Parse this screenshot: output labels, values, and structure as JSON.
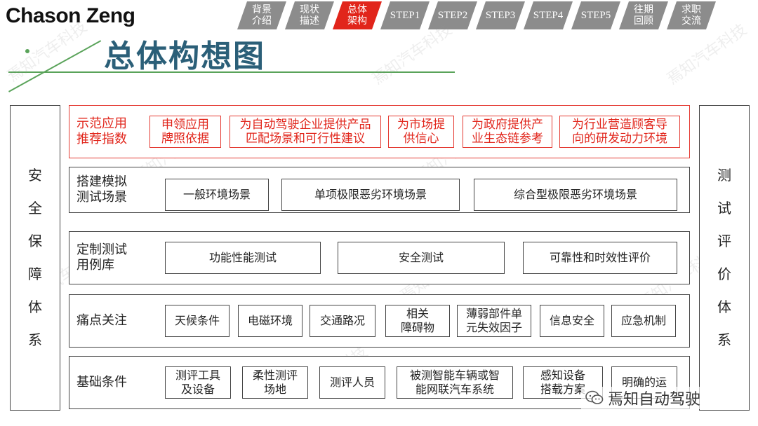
{
  "brand": "Chason Zeng",
  "title": "总体构想图",
  "nav": [
    {
      "label": "背景\n介绍",
      "active": false,
      "step": false
    },
    {
      "label": "现状\n描述",
      "active": false,
      "step": false
    },
    {
      "label": "总体\n架构",
      "active": true,
      "step": false
    },
    {
      "label": "STEP1",
      "active": false,
      "step": true
    },
    {
      "label": "STEP2",
      "active": false,
      "step": true
    },
    {
      "label": "STEP3",
      "active": false,
      "step": true
    },
    {
      "label": "STEP4",
      "active": false,
      "step": true
    },
    {
      "label": "STEP5",
      "active": false,
      "step": true
    },
    {
      "label": "往期\n回顾",
      "active": false,
      "step": false
    },
    {
      "label": "求职\n交流",
      "active": false,
      "step": false
    }
  ],
  "left_pillar": [
    "安",
    "全",
    "保",
    "障",
    "体",
    "系"
  ],
  "right_pillar": [
    "测",
    "试",
    "评",
    "价",
    "体",
    "系"
  ],
  "rows": [
    {
      "label": "示范应用\n推荐指数",
      "cells": [
        "申领应用\n牌照依据",
        "为自动驾驶企业提供产品\n匹配场景和可行性建议",
        "为市场提\n供信心",
        "为政府提供产\n业生态链参考",
        "为行业营造顾客导\n向的研发动力环境"
      ]
    },
    {
      "label": "搭建模拟\n测试场景",
      "cells": [
        "一般环境场景",
        "单项极限恶劣环境场景",
        "综合型极限恶劣环境场景"
      ]
    },
    {
      "label": "定制测试\n用例库",
      "cells": [
        "功能性能测试",
        "安全测试",
        "可靠性和时效性评价"
      ]
    },
    {
      "label": "痛点关注",
      "cells": [
        "天候条件",
        "电磁环境",
        "交通路况",
        "相关\n障碍物",
        "薄弱部件单\n元失效因子",
        "信息安全",
        "应急机制"
      ]
    },
    {
      "label": "基础条件",
      "cells": [
        "测评工具\n及设备",
        "柔性测评\n场地",
        "测评人员",
        "被测智能车辆或智\n能网联汽车系统",
        "感知设备\n搭载方案",
        "明确的运"
      ]
    }
  ],
  "watermark": "焉知汽车科技",
  "wechat_label": "焉知自动驾驶"
}
